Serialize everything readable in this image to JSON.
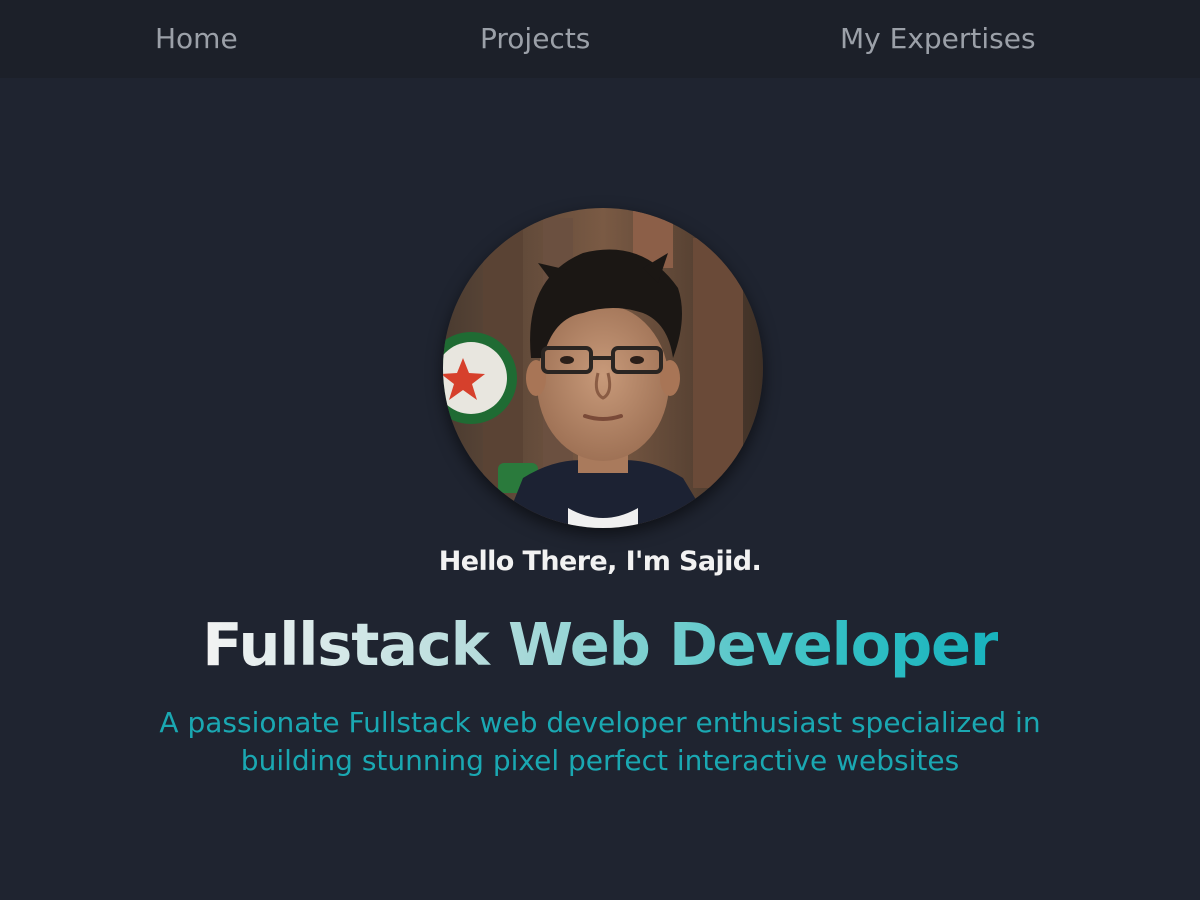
{
  "nav": {
    "home_label": "Home",
    "projects_label": "Projects",
    "expertises_label": "My Expertises"
  },
  "hero": {
    "avatar_alt": "Sajid profile photo",
    "greeting": "Hello There, I'm Sajid.",
    "headline": "Fullstack Web Developer",
    "tagline": "A passionate Fullstack web developer enthusiast specialized in building stunning pixel perfect interactive websites"
  },
  "colors": {
    "background": "#1f2430",
    "nav_background": "#1c2029",
    "nav_text": "#9ba0a8",
    "greeting_text": "#f2f2f2",
    "accent": "#1aa8b2"
  }
}
